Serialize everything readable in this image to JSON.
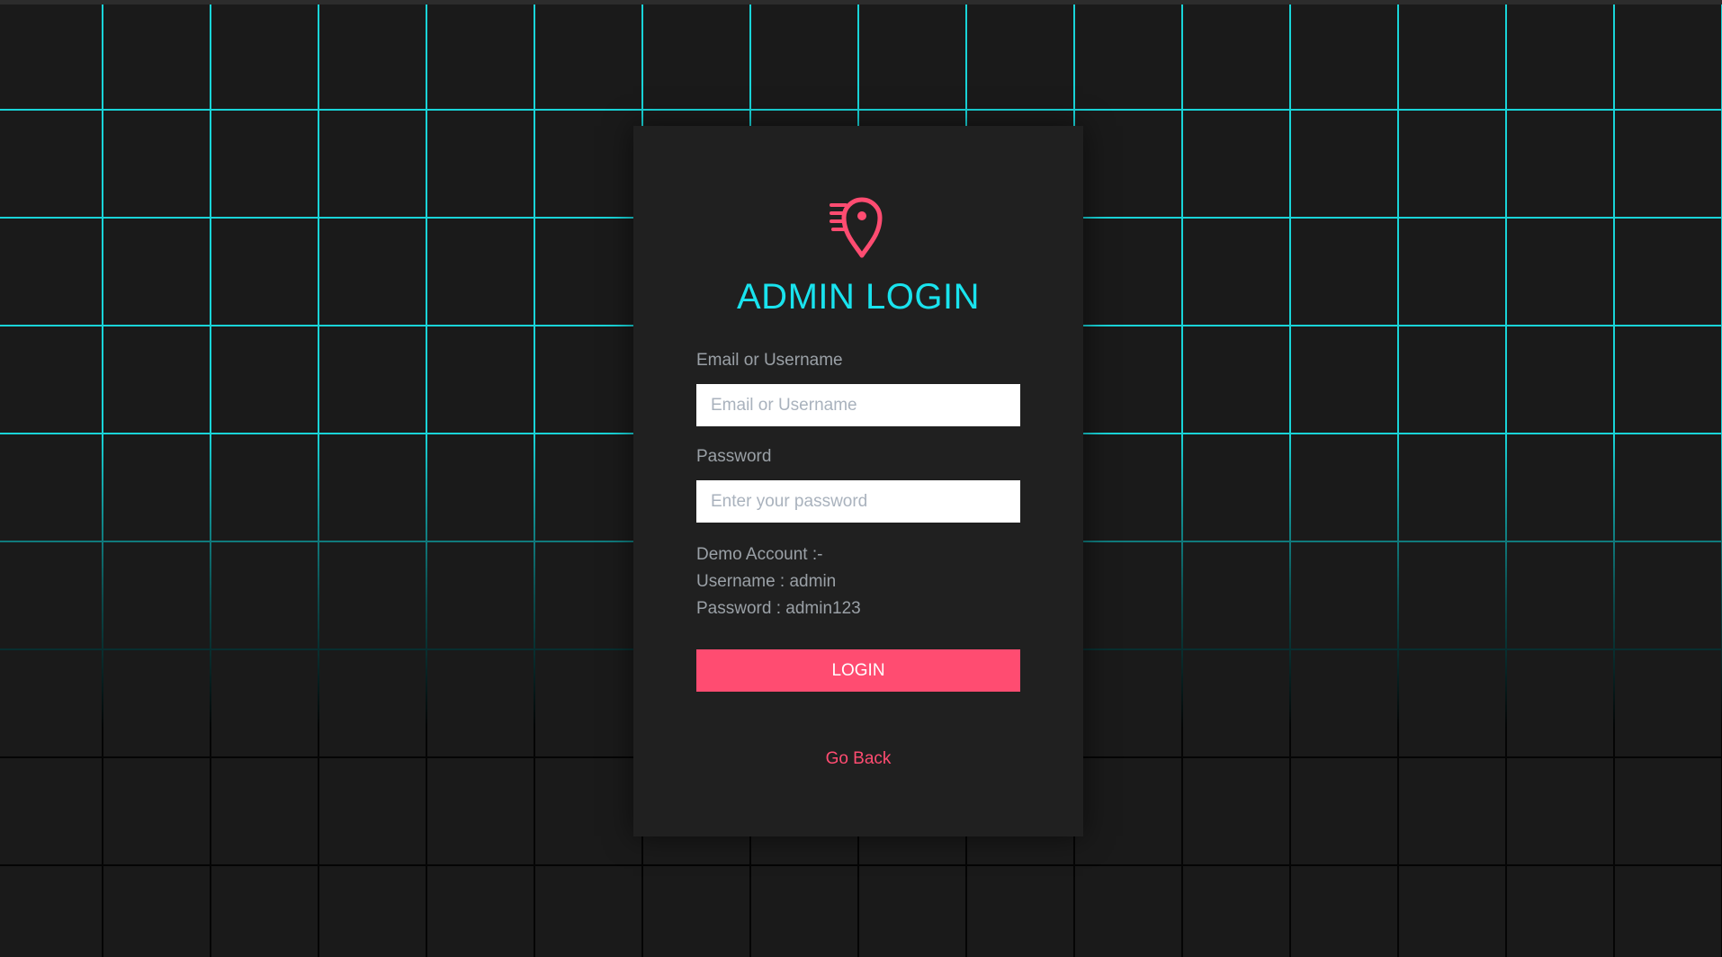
{
  "theme": {
    "accent": "#19e3ee",
    "brand": "#ff4c71",
    "background": "#1a1a1a",
    "card": "#202020",
    "grid": "#19d4d8"
  },
  "logo": {
    "icon": "location-pin-speed-icon"
  },
  "title": "ADMIN LOGIN",
  "form": {
    "username_label": "Email or Username",
    "username_placeholder": "Email or Username",
    "username_value": "",
    "password_label": "Password",
    "password_placeholder": "Enter your password",
    "password_value": ""
  },
  "demo": {
    "heading": "Demo Account :-",
    "username": "Username : admin",
    "password": "Password : admin123"
  },
  "login_button": "LOGIN",
  "go_back": "Go Back"
}
